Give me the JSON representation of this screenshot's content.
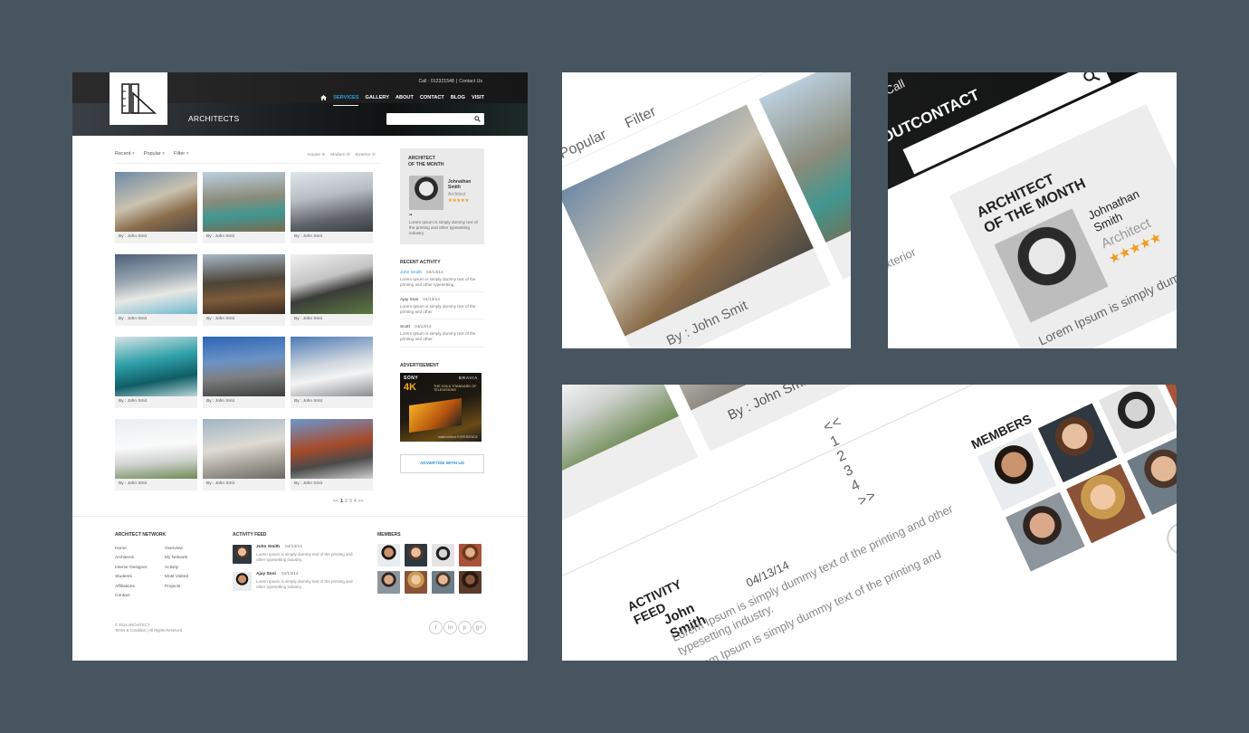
{
  "header": {
    "call": "Call : 012321548",
    "contact_link": "Contact Us",
    "brand": "ARCHITECTS",
    "nav": [
      "SERVICES",
      "GALLERY",
      "ABOUT",
      "CONTACT",
      "BLOG",
      "VISIT"
    ],
    "active_nav": "SERVICES",
    "accent": "#27a0de"
  },
  "filters": {
    "recent": "Recent",
    "popular": "Popular",
    "filter": "Filter",
    "tags": [
      "House",
      "Modern",
      "Exterior"
    ]
  },
  "gallery": {
    "caption": "By : John Smit",
    "count": 12
  },
  "architect_of_month": {
    "title_line1": "ARCHITECT",
    "title_line2": "OF THE MONTH",
    "first": "Johnathan",
    "last": "Smith",
    "role": "Architect",
    "stars": "★★★★★",
    "quote_mark": "“",
    "text": "Lorem Ipsum is simply dummy text of the printing and other typesetting industry.",
    "star_color": "#f39a1e"
  },
  "recent_activity": {
    "title": "RECENT ACTIVITY",
    "items": [
      {
        "name": "John Smith",
        "date": "04/13/14",
        "text": "Lorem Ipsum is simply dummy text of the printing and other typesetting"
      },
      {
        "name": "Ajay Soni",
        "date": "04/13/14",
        "text": "Lorem Ipsum is simply dummy text of the printing and other"
      },
      {
        "name": "Scott",
        "date": "04/13/14",
        "text": "Lorem Ipsum is simply dummy text of the printing and other"
      }
    ]
  },
  "advertisement": {
    "title": "ADVERTISEMENT",
    "sony": "SONY",
    "bravia": "BRAVIA",
    "fourk": "4K",
    "tagline": "THE GOLD STANDARD OF TELEVISIONS",
    "exp": "make.believe EXPERIENCE",
    "button": "ADVERTISE WITH US"
  },
  "pagination": {
    "prev": "<<",
    "pages": [
      "1",
      "2",
      "3",
      "4"
    ],
    "next": ">>",
    "current": "1"
  },
  "footer": {
    "network_title": "ARCHITECT NETWORK",
    "links_col1": [
      "Home",
      "Architects",
      "Interior Designer",
      "Students",
      "Affiliations",
      "Contact"
    ],
    "links_col2": [
      "Overview",
      "My Network",
      "Activity",
      "Most Visited",
      "Projects"
    ],
    "feed_title": "ACTIVITY FEED",
    "feed": [
      {
        "name": "John Smith",
        "date": "04/13/14",
        "text": "Lorem Ipsum is simply dummy text of the printing and other typesetting industry."
      },
      {
        "name": "Ajay Soni",
        "date": "04/13/14",
        "text": "Lorem Ipsum is simply dummy text of the printing and other typesetting industry."
      }
    ],
    "members_title": "MEMBERS",
    "copyright": "© 2014 ARCHITECT",
    "terms": "Terms & Condition",
    "rights": "All Rights Reserved",
    "social": [
      "f",
      "in",
      "p",
      "g+"
    ]
  },
  "detail_views": {
    "view1": {
      "popular": "Popular",
      "filter": "Filter",
      "caption": "By : John Smit"
    },
    "view2": {
      "call": "Call",
      "about": "ABOUT",
      "contact": "CONTACT",
      "exterior": "Exterior"
    },
    "view3": {
      "caption": "By : John Smit",
      "pager": "<< 1 2 3 4 >>",
      "members": "MEMBERS",
      "feed_title": "ACTIVITY FEED",
      "feed_name": "John Smith",
      "feed_date": "04/13/14",
      "feed_text": "Lorem Ipsum is simply dummy text of the printing and other typesetting industry.",
      "feed_text2": "Lorem Ipsum is simply dummy text of the printing and"
    }
  }
}
